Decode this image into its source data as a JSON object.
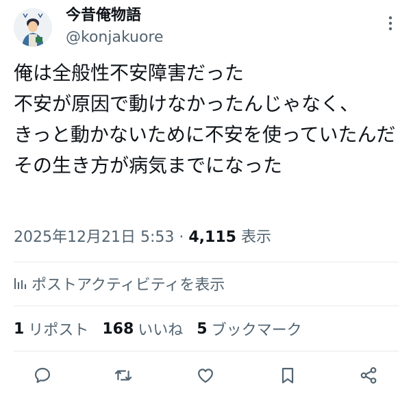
{
  "user": {
    "display_name": "今昔俺物語",
    "handle": "@konjakuore",
    "avatar_icon": "avatar-illustration-icon"
  },
  "tweet": {
    "lines": [
      "俺は全般性不安障害だった",
      "不安が原因で動けなかったんじゃなく、",
      "きっと動かないために不安を使っていたんだ",
      "その生き方が病気までになった"
    ]
  },
  "meta": {
    "datetime": "2025年12月21日 5:53",
    "separator": " · ",
    "views_count": "4,115",
    "views_label": " 表示"
  },
  "activity": {
    "icon": "analytics-icon",
    "label": "ポストアクティビティを表示"
  },
  "stats": {
    "reposts_count": "1",
    "reposts_label": "リポスト",
    "likes_count": "168",
    "likes_label": "いいね",
    "bookmarks_count": "5",
    "bookmarks_label": "ブックマーク"
  },
  "actions": {
    "reply_icon": "reply-icon",
    "repost_icon": "repost-icon",
    "like_icon": "heart-icon",
    "bookmark_icon": "bookmark-icon",
    "share_icon": "share-icon"
  },
  "colors": {
    "text_primary": "#0f1419",
    "text_secondary": "#536471",
    "divider": "#e6e9ec",
    "icon": "#536471"
  }
}
